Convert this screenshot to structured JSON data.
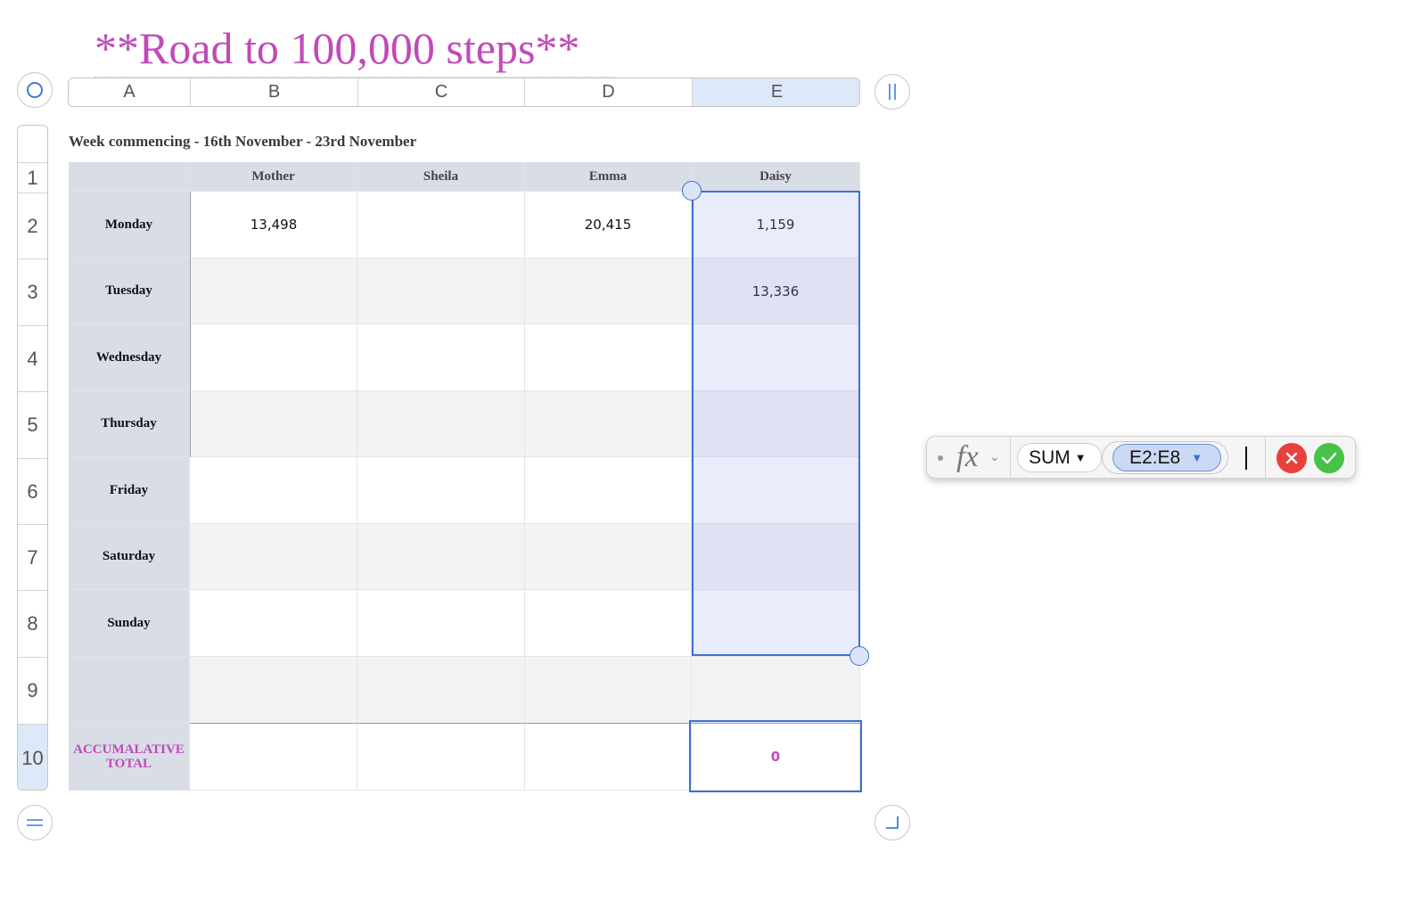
{
  "sheet": {
    "title": "**Road to 100,000 steps**",
    "caption": "Week commencing - 16th November - 23rd November"
  },
  "columns": [
    "A",
    "B",
    "C",
    "D",
    "E"
  ],
  "rows": [
    "1",
    "2",
    "3",
    "4",
    "5",
    "6",
    "7",
    "8",
    "9",
    "10"
  ],
  "table": {
    "headers": [
      "",
      "Mother",
      "Sheila",
      "Emma",
      "Daisy"
    ],
    "days": [
      "Monday",
      "Tuesday",
      "Wednesday",
      "Thursday",
      "Friday",
      "Saturday",
      "Sunday",
      ""
    ],
    "values": {
      "monday_mother": "13,498",
      "monday_emma": "20,415",
      "monday_daisy": "1,159",
      "tuesday_daisy": "13,336"
    },
    "total_label": "ACCUMALATIVE TOTAL",
    "total_daisy": "0"
  },
  "formula_bar": {
    "fx_label": "fx",
    "function": "SUM",
    "range": "E2:E8"
  },
  "colors": {
    "accent": "#3d6fd1",
    "title": "#c14ab8",
    "cancel": "#e8413c",
    "confirm": "#45c247"
  }
}
